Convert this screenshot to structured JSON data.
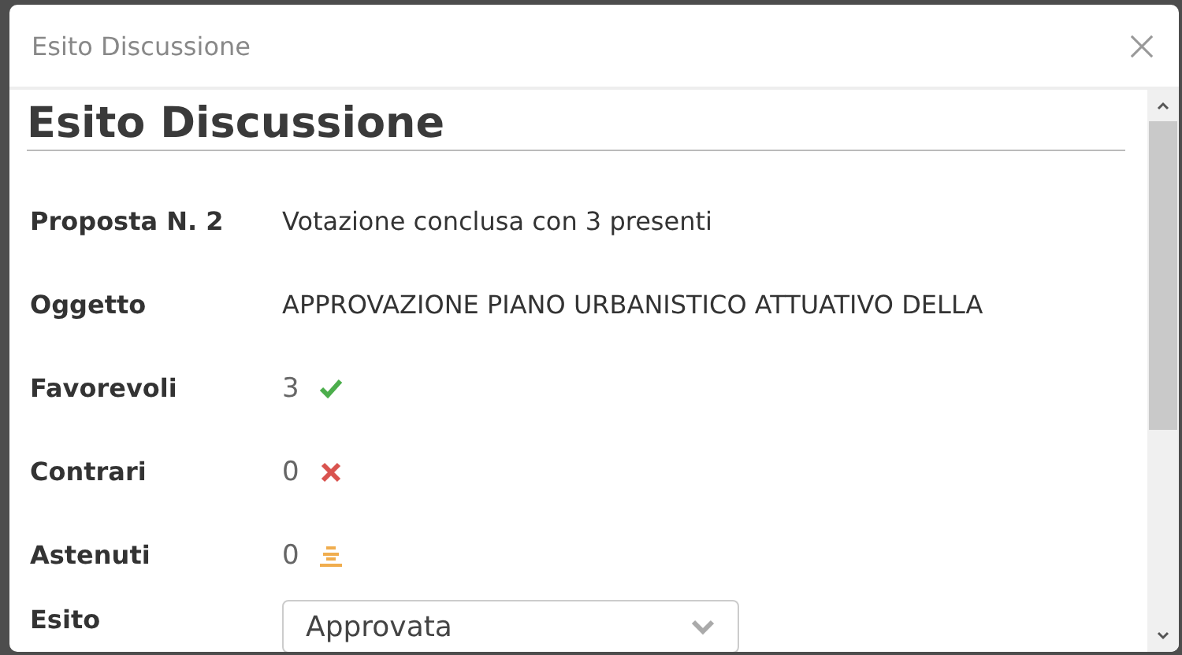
{
  "dialog": {
    "title": "Esito Discussione"
  },
  "heading": "Esito Discussione",
  "fields": [
    {
      "label": "Proposta N. 2",
      "kind": "text",
      "value": "Votazione conclusa con 3 presenti"
    },
    {
      "label": "Oggetto",
      "kind": "text",
      "value": "APPROVAZIONE PIANO URBANISTICO ATTUATIVO DELLA"
    },
    {
      "label": "Favorevoli",
      "kind": "yes",
      "value": "3"
    },
    {
      "label": "Contrari",
      "kind": "no",
      "value": "0"
    },
    {
      "label": "Astenuti",
      "kind": "abstain",
      "value": "0"
    },
    {
      "label": "Esito",
      "kind": "select",
      "value": "Approvata"
    }
  ]
}
